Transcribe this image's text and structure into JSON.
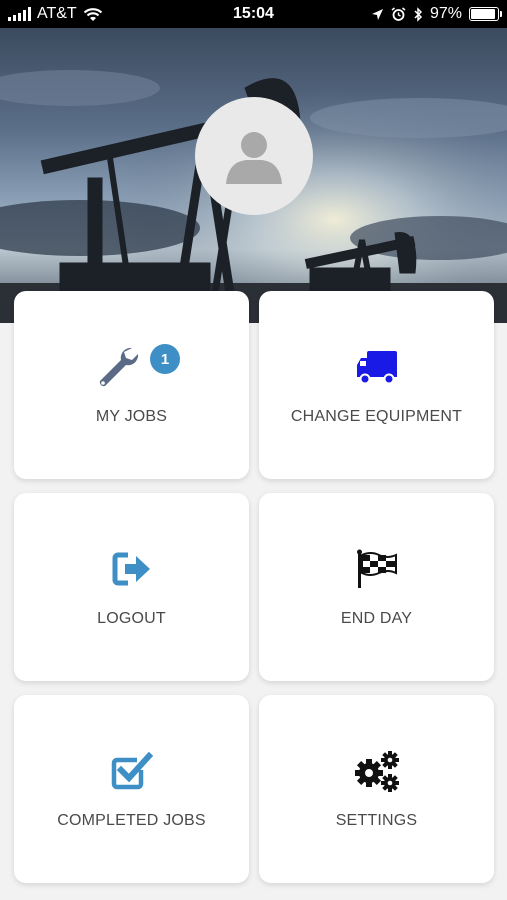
{
  "status_bar": {
    "carrier": "AT&T",
    "time": "15:04",
    "battery_percent": "97%",
    "battery_level": 0.97
  },
  "profile": {
    "avatar_icon": "user-silhouette-icon"
  },
  "tiles": [
    {
      "label": "MY JOBS",
      "icon": "wrench-icon",
      "badge": "1",
      "color": "#5b6a86"
    },
    {
      "label": "CHANGE EQUIPMENT",
      "icon": "truck-icon",
      "color": "#1a1ae6"
    },
    {
      "label": "LOGOUT",
      "icon": "logout-icon",
      "color": "#3d8fc6"
    },
    {
      "label": "END DAY",
      "icon": "checkered-flag-icon",
      "color": "#111111"
    },
    {
      "label": "COMPLETED JOBS",
      "icon": "checkbox-icon",
      "color": "#3d8fc6"
    },
    {
      "label": "SETTINGS",
      "icon": "gears-icon",
      "color": "#111111"
    }
  ]
}
